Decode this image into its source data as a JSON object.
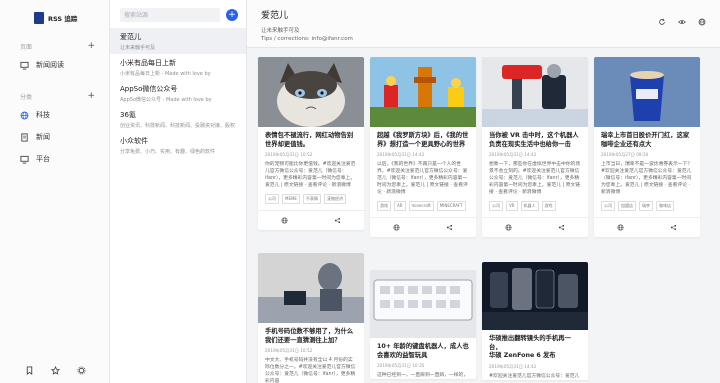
{
  "app": {
    "name": "RSS 追踪"
  },
  "nav": {
    "groups": [
      {
        "label": "页面",
        "items": [
          {
            "label": "新闻阅读",
            "icon": "monitor-icon"
          }
        ]
      },
      {
        "label": "分类",
        "items": [
          {
            "label": "科技",
            "icon": "globe-icon"
          },
          {
            "label": "新闻",
            "icon": "document-icon"
          },
          {
            "label": "平台",
            "icon": "monitor-icon"
          }
        ]
      }
    ],
    "bottom_icons": [
      "bookmark-icon",
      "star-icon",
      "gear-icon"
    ]
  },
  "search": {
    "placeholder": "搜索站源"
  },
  "sources": [
    {
      "title": "爱范儿",
      "subtitle": "让未来触手可及"
    },
    {
      "title": "小米有品每日上新",
      "subtitle": "小米有品每日上新 - Made with love by"
    },
    {
      "title": "AppSo微信公众号",
      "subtitle": "AppSo微信公众号 - Made with love by"
    },
    {
      "title": "36氪",
      "subtitle": "创业资讯、科技新闻、科技新闻、投融资对接、股权"
    },
    {
      "title": "小众软件",
      "subtitle": "分享免费、小巧、实用、有趣、绿色的软件"
    }
  ],
  "header": {
    "title": "爱范儿",
    "subtitle": "让未来触手可及",
    "contact": "Tips / corrections: info@ifanr.com"
  },
  "cards": [
    {
      "title": "表情包不褪流行，网红动物告别世界却更值钱。",
      "meta": "2019年05月31日 10:52",
      "excerpt": "你的宠物可能比你更值钱。#欢迎关注爱范儿官方微信公众号：爱范儿（微信号：ifanr），更多精彩内容第一时间为您奉上。爱范儿 | 原文链接 · 查看评论 · 新浪微博",
      "tags": [
        "公司",
        "MEME",
        "不表情",
        "宠物经济"
      ]
    },
    {
      "title": "超越《我罗斯方块》后，《我的世界》想打造一个更具野心的世界",
      "meta": "2019年05月31日 14:42",
      "excerpt": "以后，《我的世界》不再只是一个人的世界。#欢迎关注爱范儿官方微信公众号：爱范儿（微信号：ifanr），更多精彩内容第一时间为您奉上。爱范儿 | 原文链接 · 查看评论 · 新浪微博",
      "tags": [
        "游戏",
        "AR",
        "minecraft",
        "MINECRAFT"
      ]
    },
    {
      "title": "当你被 VR 击中时，这个机器人负责在现实生活中也给你一击",
      "meta": "2019年05月31日 14:42",
      "excerpt": "想象一下，那些你在虚拟世界中击中你的场景不会立刻的。#欢迎关注爱范儿官方微信公众号：爱范儿（微信号：ifanr），更多精彩内容第一时间为您奉上。爱范儿 | 原文链接 · 查看评论 · 新浪微博",
      "tags": [
        "公司",
        "VR",
        "机器人",
        "游戏"
      ]
    },
    {
      "title": "瑞幸上市首日股价开门红，这家咖啡企业还有点大",
      "meta": "2019年05月27日 09:50",
      "excerpt": "上市当日，瑞幸不是一波优惠券表示一下？#欢迎关注爱范儿官方微信公众号：爱范儿（微信号：ifanr），更多精彩内容第一时间为您奉上。爱范儿 | 原文链接 · 查看评论 · 新浪微博",
      "tags": [
        "公司",
        "加盟店",
        "瑞幸",
        "咖啡店"
      ]
    },
    {
      "title": "手机号码位数不够用了，为什么我们还要一直猜测往上加？",
      "meta": "2019年05月31日 10:52",
      "excerpt": "中文大、手机号码并没有全以 4 月份的实际位数分之一。#欢迎关注爱范儿官方微信公众号：爱范儿（微信号：ifanr），更多精彩内容",
      "tags": []
    },
    {
      "title": "10+ 年龄的键盘机器人，成人也会喜欢的益智玩具",
      "meta": "2019年05月31日 10:35",
      "excerpt": "这种已经到一，一直辨到一直辨，一样的，",
      "tags": []
    },
    {
      "title": "华硕 ZenFone 6 发布",
      "title_lead": "华硕推出翻转镜头的手机再一台，",
      "meta": "2019年05月31日 14:42",
      "excerpt": "#欢迎关注爱范儿官方微信公众号：爱范儿",
      "tags": []
    }
  ],
  "colors": {
    "accent": "#2563eb",
    "logo": "#1e3a8a"
  }
}
